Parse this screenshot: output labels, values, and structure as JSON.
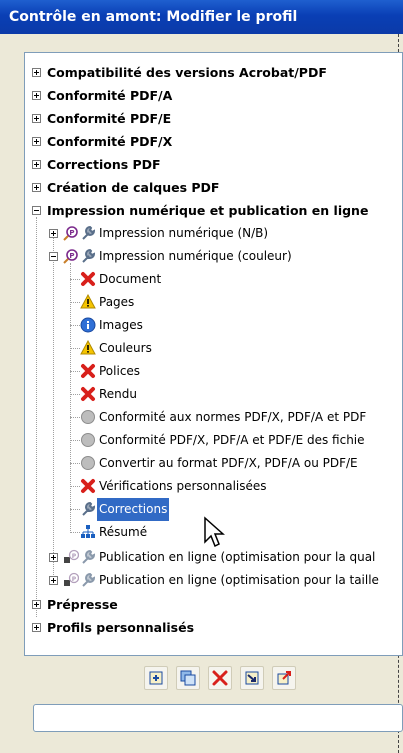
{
  "window": {
    "title": "Contrôle en amont: Modifier le profil"
  },
  "tree": {
    "top_items": [
      "Compatibilité des versions Acrobat/PDF",
      "Conformité PDF/A",
      "Conformité PDF/E",
      "Conformité PDF/X",
      "Corrections PDF",
      "Création de calques PDF",
      "Impression numérique et publication en ligne"
    ],
    "child_bw": "Impression numérique (N/B)",
    "child_color": "Impression numérique (couleur)",
    "color_children": [
      "Document",
      "Pages",
      "Images",
      "Couleurs",
      "Polices",
      "Rendu",
      "Conformité aux normes PDF/X, PDF/A et PDF",
      "Conformité PDF/X, PDF/A et PDF/E des fichie",
      "Convertir au format PDF/X, PDF/A ou PDF/E",
      "Vérifications personnalisées",
      "Corrections",
      "Résumé"
    ],
    "online_1": "Publication en ligne (optimisation pour la qual",
    "online_2": "Publication en ligne (optimisation pour la taille",
    "bottom_items": [
      "Prépresse",
      "Profils personnalisés"
    ]
  },
  "input": {
    "value": ""
  }
}
